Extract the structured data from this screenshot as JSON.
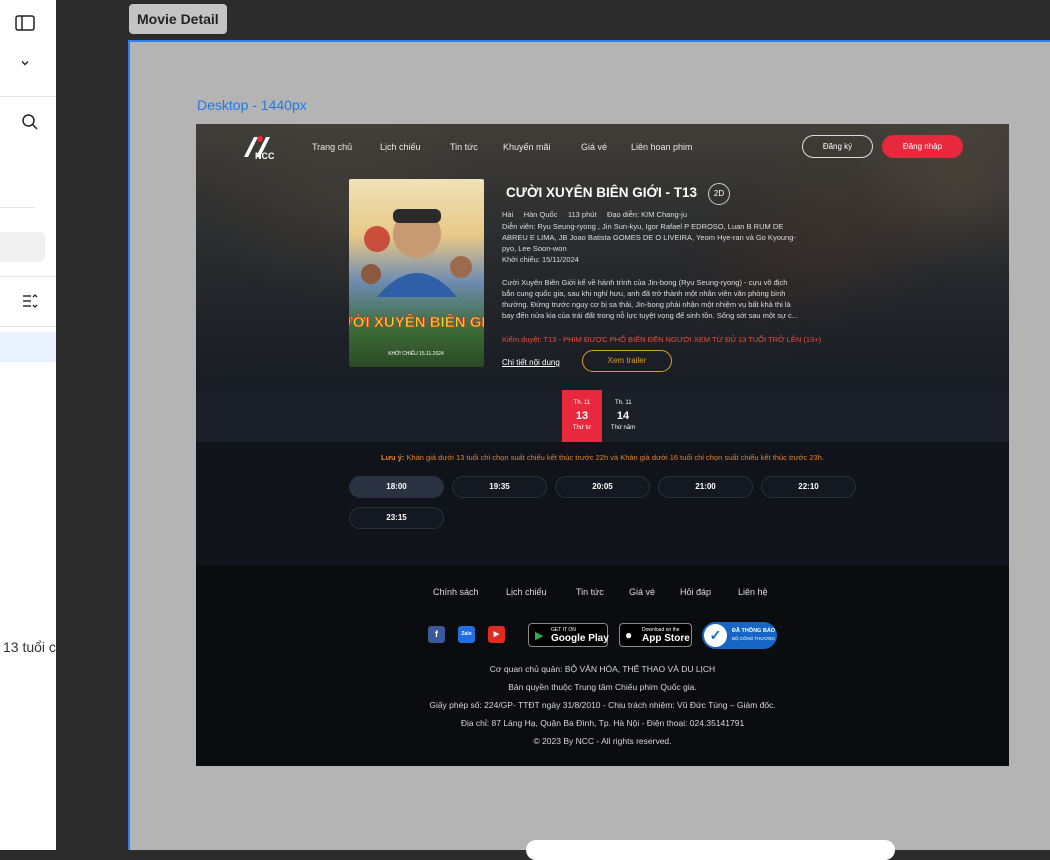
{
  "left_panel": {
    "icons": [
      "sidebar-toggle-icon",
      "chevron-down-icon",
      "search-icon",
      "list-sort-icon"
    ],
    "clipped_text": "13 tuổi c"
  },
  "canvas": {
    "frame_tag": "Movie Detail",
    "frame_label": "Desktop - 1440px"
  },
  "site": {
    "logo_text": "NCC",
    "nav": [
      "Trang chủ",
      "Lịch chiếu",
      "Tin tức",
      "Khuyến mãi",
      "Giá vé",
      "Liên hoan phim"
    ],
    "register": "Đăng ký",
    "login": "Đăng nhập"
  },
  "movie": {
    "poster_title": "CƯỜI XUYÊN BIÊN GIỚI",
    "poster_date": "KHỞI CHIẾU 15.11.2024",
    "title": "CƯỜI XUYÊN BIÊN GIỚI - T13",
    "format": "2D",
    "genre": "Hài",
    "country": "Hàn Quốc",
    "duration": "113 phút",
    "director": "Đạo diễn: KIM Chang-ju",
    "cast_lines": [
      "Diễn viên: Ryu Seung-ryong , Jin Sun-kyu, Igor Rafael P EDROSO, Luan B RUM DE",
      "ABREU E LIMA, JB Joao Batista GOMES DE O LIVEIRA, Yeom Hye-ran và Go Kyoung-",
      "pyo, Lee Soon-won"
    ],
    "release": "Khởi chiếu: 15/11/2024",
    "synopsis_lines": [
      "Cười Xuyên Biên Giới kể về hành trình của Jin-bong (Ryu Seung-ryong) - cựu vô địch",
      "bắn cung quốc gia, sau khi nghỉ hưu, anh đã trở thành một nhân viên văn phòng bình",
      "thường. Đứng trước nguy cơ bị sa thải, Jin-bong phải nhận một nhiệm vụ bất khả thi là",
      "bay đến nửa kia của trái đất trong nỗ lực tuyệt vọng để sinh tồn. Sống sót sau một sự c..."
    ],
    "rating": "Kiểm duyệt: T13 - PHIM ĐƯỢC PHỔ BIẾN ĐẾN NGƯỜI XEM TỪ ĐỦ 13 TUỔI TRỞ LÊN (13+)",
    "detail_link": "Chi tiết nội dung",
    "trailer_button": "Xem trailer"
  },
  "dates": [
    {
      "month": "Th. 11",
      "day": "13",
      "weekday": "Thứ tư",
      "selected": true
    },
    {
      "month": "Th. 11",
      "day": "14",
      "weekday": "Thứ năm",
      "selected": false
    }
  ],
  "showtimes": {
    "note_label": "Lưu ý:",
    "note": " Khán giả dưới 13 tuổi chỉ chọn suất chiếu kết thúc trước 22h và Khán giả dưới 16 tuổi chỉ chọn suất chiếu kết thúc trước 23h.",
    "times": [
      "18:00",
      "19:35",
      "20:05",
      "21:00",
      "22:10",
      "23:15"
    ],
    "selected": "18:00"
  },
  "footer": {
    "links": [
      "Chính sách",
      "Lịch chiếu",
      "Tin tức",
      "Giá vé",
      "Hỏi đáp",
      "Liên hệ"
    ],
    "social": [
      "f",
      "Zalo",
      "▶"
    ],
    "google_small": "GET IT ON",
    "google_big": "Google Play",
    "apple_small": "Download on the",
    "apple_big": "App Store",
    "bct_top": "ĐÃ THÔNG BÁO",
    "bct_bottom": "BỘ CÔNG THƯƠNG",
    "info": [
      "Cơ quan chủ quản: BỘ VĂN HÓA, THỂ THAO VÀ DU LỊCH",
      "Bản quyền thuộc Trung tâm Chiếu phim Quốc gia.",
      "Giấy phép số: 224/GP- TTĐT ngày 31/8/2010 - Chịu trách nhiệm: Vũ Đức Tùng – Giám đốc.",
      "Địa chỉ: 87 Láng Hạ, Quận Ba Đình, Tp. Hà Nội - Điện thoại: 024.35141791",
      "© 2023 By NCC - All rights reserved."
    ]
  },
  "colors": {
    "accent_red": "#e8283c",
    "trailer_gold": "#d9a018",
    "note_orange": "#e2862a",
    "frame_blue": "#2f80ed"
  }
}
